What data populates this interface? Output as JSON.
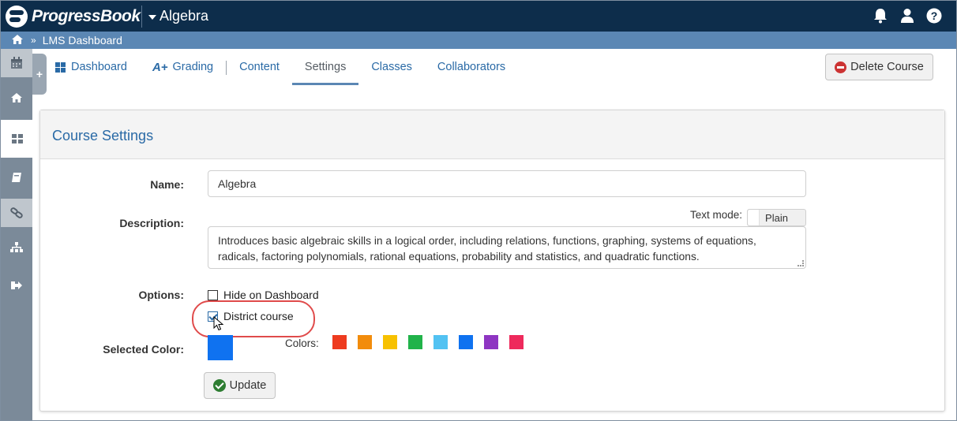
{
  "header": {
    "brand": "ProgressBook",
    "course": "Algebra",
    "icons": [
      "bell-icon",
      "user-icon",
      "help-icon"
    ]
  },
  "breadcrumb": {
    "home_icon": "home-icon",
    "current": "LMS Dashboard"
  },
  "sidebar": {
    "items": [
      "calendar-icon",
      "home-icon",
      "dashboard-icon",
      "book-icon",
      "link-icon",
      "sitemap-icon",
      "sign-out-icon"
    ],
    "active": "dashboard-icon",
    "tab_label": "+"
  },
  "tabs": [
    {
      "label": "Dashboard",
      "icon": "grid-icon"
    },
    {
      "label": "Grading",
      "icon": "grading-icon",
      "icon_text": "A+"
    },
    {
      "label": "Content"
    },
    {
      "label": "Settings",
      "active": true
    },
    {
      "label": "Classes"
    },
    {
      "label": "Collaborators"
    }
  ],
  "delete_button": "Delete Course",
  "panel": {
    "title": "Course Settings",
    "name_label": "Name:",
    "name_value": "Algebra",
    "description_label": "Description:",
    "text_mode_label": "Text mode:",
    "text_mode_value": "Plain",
    "description_text": "Introduces basic algebraic skills in a logical order, including relations, functions, graphing, systems of equations, radicals, factoring polynomials, rational equations, probability and statistics, and quadratic functions.",
    "options_label": "Options:",
    "options": [
      {
        "label": "Hide on Dashboard",
        "checked": false
      },
      {
        "label": "District course",
        "checked": true
      }
    ],
    "selected_color_label": "Selected Color:",
    "selected_color": "#0f72f0",
    "colors_label": "Colors:",
    "colors": [
      "#ee3b1f",
      "#f28c0c",
      "#f7c100",
      "#21b34a",
      "#52c2f2",
      "#0f72f0",
      "#8e35c2",
      "#ee2a5c"
    ],
    "update_button": "Update"
  },
  "colors": {
    "topbar": "#0d2d4b",
    "crumbbar": "#5b87b4",
    "link": "#2a6aa6",
    "highlight": "#e04b4b"
  }
}
